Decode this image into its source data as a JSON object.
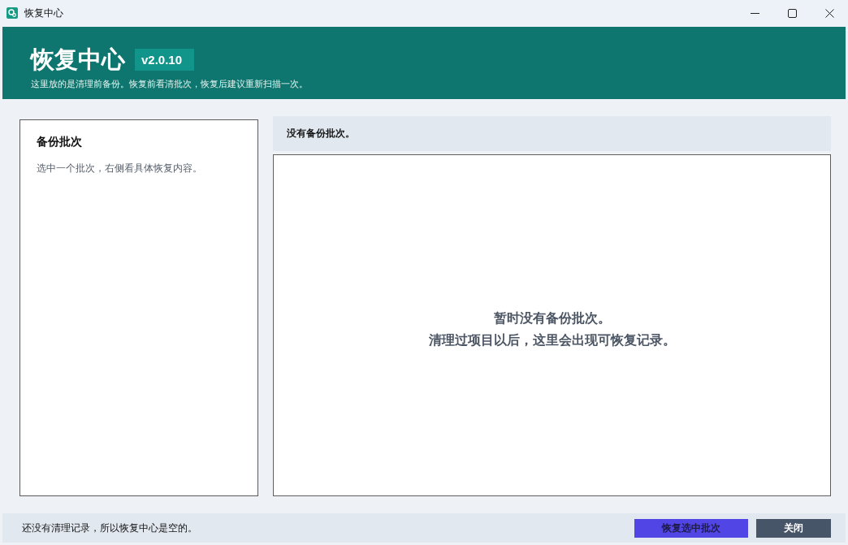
{
  "window": {
    "title": "恢复中心"
  },
  "header": {
    "title": "恢复中心",
    "version": "v2.0.10",
    "subtitle": "这里放的是清理前备份。恢复前看清批次，恢复后建议重新扫描一次。"
  },
  "batch_panel": {
    "title": "备份批次",
    "hint": "选中一个批次，右侧看具体恢复内容。"
  },
  "detail_panel": {
    "status": "没有备份批次。",
    "empty_message": [
      "暂时没有备份批次。",
      "清理过项目以后，这里会出现可恢复记录。"
    ]
  },
  "status_bar": {
    "text": "还没有清理记录，所以恢复中心是空的。",
    "buttons": [
      {
        "label": "恢复选中批次",
        "kind": "primary"
      },
      {
        "label": "关闭",
        "kind": "secondary"
      }
    ]
  }
}
